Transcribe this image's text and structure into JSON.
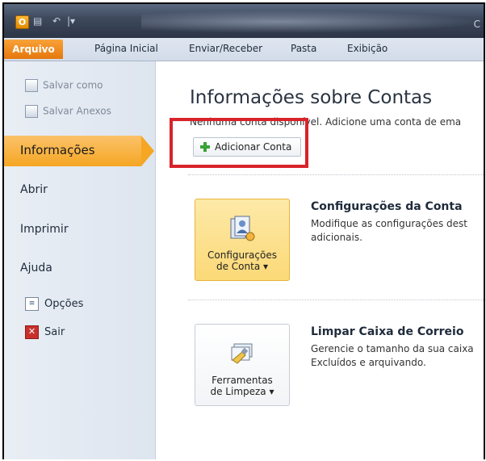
{
  "window": {
    "title_fragment": "C"
  },
  "quick_access": {
    "app_letter": "O"
  },
  "ribbon": {
    "file_tab": "Arquivo",
    "tabs": [
      "Página Inicial",
      "Enviar/Receber",
      "Pasta",
      "Exibição"
    ]
  },
  "backstage": {
    "save_as": "Salvar como",
    "save_attachments": "Salvar Anexos",
    "active_item": "Informações",
    "items": [
      "Abrir",
      "Imprimir",
      "Ajuda"
    ],
    "options": "Opções",
    "exit": "Sair"
  },
  "main": {
    "title": "Informações sobre Contas",
    "subtitle": "Nenhuma conta disponível. Adicione uma conta de ema",
    "add_account_button": "Adicionar Conta",
    "account_settings": {
      "button_line1": "Configurações",
      "button_line2": "de Conta ▾",
      "title": "Configurações da Conta",
      "desc_line1": "Modifique as configurações dest",
      "desc_line2": "adicionais."
    },
    "cleanup": {
      "button_line1": "Ferramentas",
      "button_line2": "de Limpeza ▾",
      "title": "Limpar Caixa de Correio",
      "desc_line1": "Gerencie o tamanho da sua caixa",
      "desc_line2": "Excluídos e arquivando."
    }
  },
  "colors": {
    "accent": "#f5a623",
    "highlight": "#d8232a",
    "file_tab": "#e5770d"
  }
}
